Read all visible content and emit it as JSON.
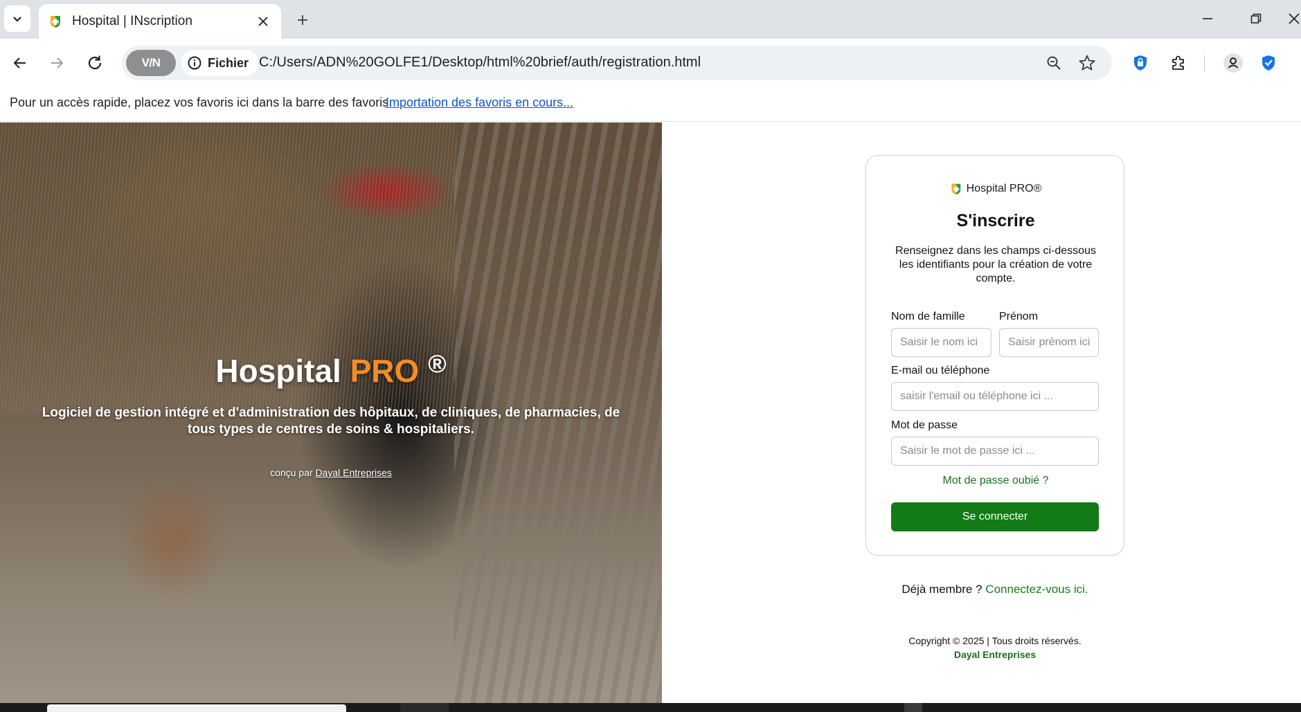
{
  "browser": {
    "tab_title": "Hospital | INscription",
    "vpn_label": "V/N",
    "site_info_label": "Fichier",
    "url": "C:/Users/ADN%20GOLFE1/Desktop/html%20brief/auth/registration.html",
    "bookmarks_hint": "Pour un accès rapide, placez vos favoris ici dans la barre des favoris.",
    "bookmarks_import_link": "Importation des favoris en cours..."
  },
  "hero": {
    "title_main": "Hospital ",
    "title_accent": "PRO",
    "title_reg": "®",
    "subtitle": "Logiciel de gestion intégré et d'administration des hôpitaux, de cliniques, de pharmacies, de tous types de centres de soins & hospitaliers.",
    "credit_prefix": "conçu par",
    "credit_link": "Dayal Entreprises"
  },
  "form": {
    "brand": "Hospital PRO®",
    "title": "S'inscrire",
    "description": "Renseignez dans les champs ci-dessous les identifiants pour la création de votre compte.",
    "lastname_label": "Nom de famille",
    "lastname_placeholder": "Saisir le nom ici",
    "firstname_label": "Prénom",
    "firstname_placeholder": "Saisir prénom ici",
    "contact_label": "E-mail ou téléphone",
    "contact_placeholder": "saisir l'email ou téléphone ici ...",
    "password_label": "Mot de passe",
    "password_placeholder": "Saisir le mot de passe ici ...",
    "forgot_link": "Mot de passe oubié ?",
    "submit_label": "Se connecter"
  },
  "footer": {
    "already_text": "Déjà membre ?",
    "login_link": "Connectez-vous ici.",
    "copyright": "Copyright © 2025 | Tous droits réservés.",
    "company": "Dayal Entreprises"
  },
  "colors": {
    "accent_orange": "#f28c28",
    "primary_green": "#127a17",
    "link_green": "#1a7a1a",
    "link_blue": "#0b57d0"
  },
  "icons": [
    "chevron-down-icon",
    "favicon-icon",
    "close-icon",
    "plus-icon",
    "minimize-icon",
    "restore-icon",
    "back-arrow-icon",
    "forward-arrow-icon",
    "reload-icon",
    "info-icon",
    "zoom-icon",
    "star-icon",
    "lock-shield-icon",
    "extensions-icon",
    "profile-icon",
    "verified-shield-icon"
  ]
}
